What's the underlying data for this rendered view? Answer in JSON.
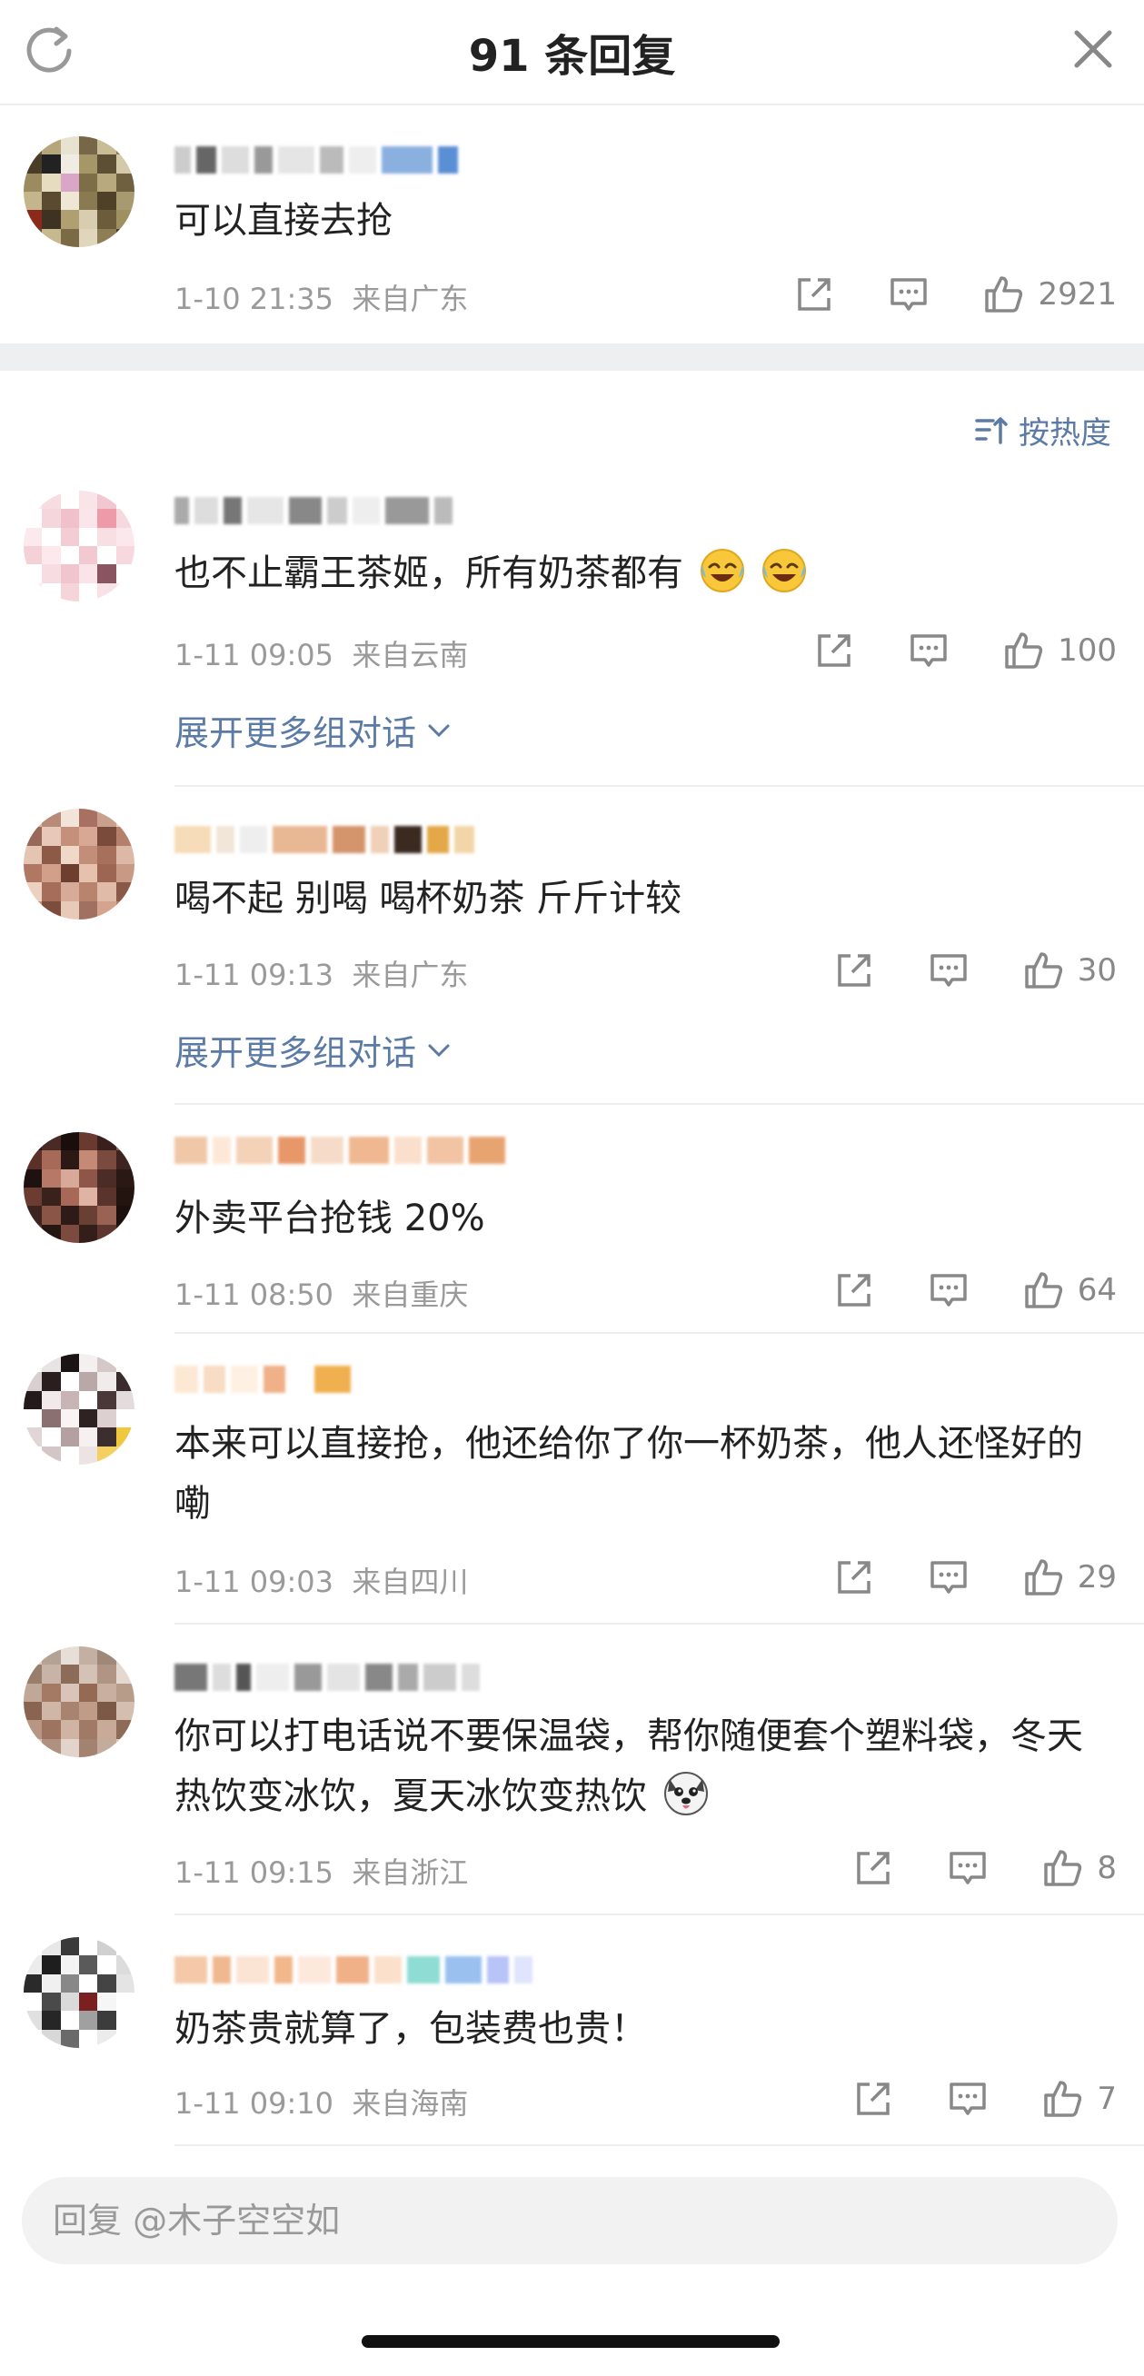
{
  "header": {
    "title": "91 条回复",
    "refresh_icon": "refresh-icon",
    "close_icon": "close-icon"
  },
  "root_comment": {
    "text": "可以直接去抢",
    "time": "1-10 21:35",
    "location": "来自广东",
    "likes": "2921"
  },
  "sort": {
    "label": "按热度",
    "icon": "sort-icon"
  },
  "comments": [
    {
      "text": "也不止霸王茶姬，所有奶茶都有",
      "emoji": "laughing-tears",
      "time": "1-11 09:05",
      "location": "来自云南",
      "likes": "100",
      "expand": "展开更多组对话"
    },
    {
      "text": "喝不起 别喝  喝杯奶茶 斤斤计较",
      "time": "1-11 09:13",
      "location": "来自广东",
      "likes": "30",
      "expand": "展开更多组对话"
    },
    {
      "text": "外卖平台抢钱 20%",
      "time": "1-11 08:50",
      "location": "来自重庆",
      "likes": "64"
    },
    {
      "text": "本来可以直接抢，他还给你了你一杯奶茶，他人还怪好的嘞",
      "time": "1-11 09:03",
      "location": "来自四川",
      "likes": "29"
    },
    {
      "text": "你可以打电话说不要保温袋，帮你随便套个塑料袋，冬天热饮变冰饮，夏天冰饮变热饮",
      "emoji": "dog-face",
      "time": "1-11 09:15",
      "location": "来自浙江",
      "likes": "8"
    },
    {
      "text": "奶茶贵就算了，包装费也贵！",
      "time": "1-11 09:10",
      "location": "来自海南",
      "likes": "7"
    }
  ],
  "reply_bar": {
    "placeholder": "回复 @木子空空如"
  },
  "colors": {
    "link": "#5b7aa5",
    "meta": "#9a9a9a",
    "band": "#eeeff1"
  }
}
